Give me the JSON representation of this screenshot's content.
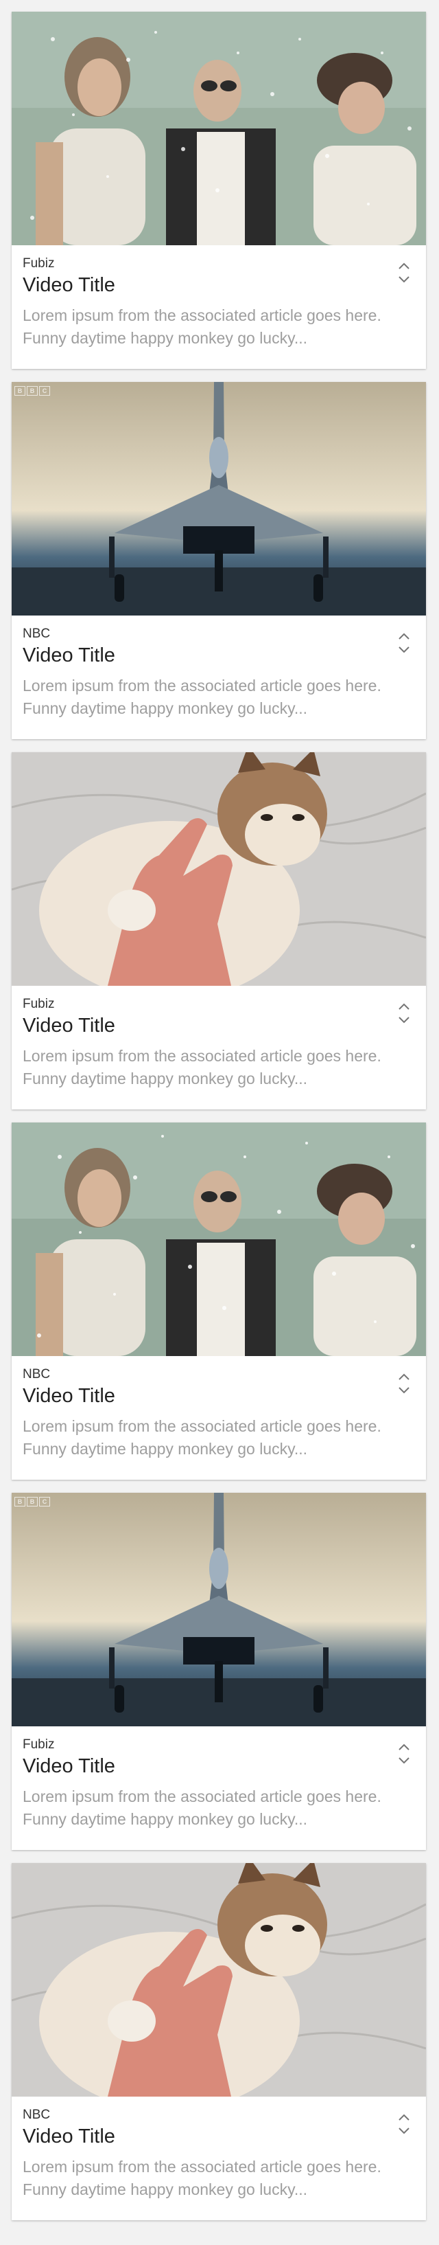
{
  "cards": [
    {
      "image": "snowy-trio-thumbnail",
      "source": "Fubiz",
      "title": "Video Title",
      "description": "Lorem ipsum from the associated article goes here. Funny daytime happy monkey go lucky...",
      "toggle_icon": "expand-collapse-chevrons-icon"
    },
    {
      "image": "fighter-jet-thumbnail",
      "source": "NBC",
      "title": "Video Title",
      "description": "Lorem ipsum from the associated article goes here. Funny daytime happy monkey go lucky...",
      "toggle_icon": "expand-collapse-chevrons-icon",
      "badge": [
        "B",
        "B",
        "C"
      ]
    },
    {
      "image": "grumpy-cat-thumbnail",
      "source": "Fubiz",
      "title": "Video Title",
      "description": "Lorem ipsum from the associated article goes here. Funny daytime happy monkey go lucky...",
      "toggle_icon": "expand-collapse-chevrons-icon"
    },
    {
      "image": "snowy-trio-thumbnail",
      "source": "NBC",
      "title": "Video Title",
      "description": "Lorem ipsum from the associated article goes here. Funny daytime happy monkey go lucky...",
      "toggle_icon": "expand-collapse-chevrons-icon"
    },
    {
      "image": "fighter-jet-thumbnail",
      "source": "Fubiz",
      "title": "Video Title",
      "description": "Lorem ipsum from the associated article goes here. Funny daytime happy monkey go lucky...",
      "toggle_icon": "expand-collapse-chevrons-icon",
      "badge": [
        "B",
        "B",
        "C"
      ]
    },
    {
      "image": "grumpy-cat-thumbnail",
      "source": "NBC",
      "title": "Video Title",
      "description": "Lorem ipsum from the associated article goes here. Funny daytime happy monkey go lucky...",
      "toggle_icon": "expand-collapse-chevrons-icon"
    }
  ],
  "colors": {
    "card_background": "#ffffff",
    "page_background": "#f2f2f2",
    "title_text": "#212121",
    "source_text": "#333333",
    "description_text": "#9e9e9e"
  }
}
